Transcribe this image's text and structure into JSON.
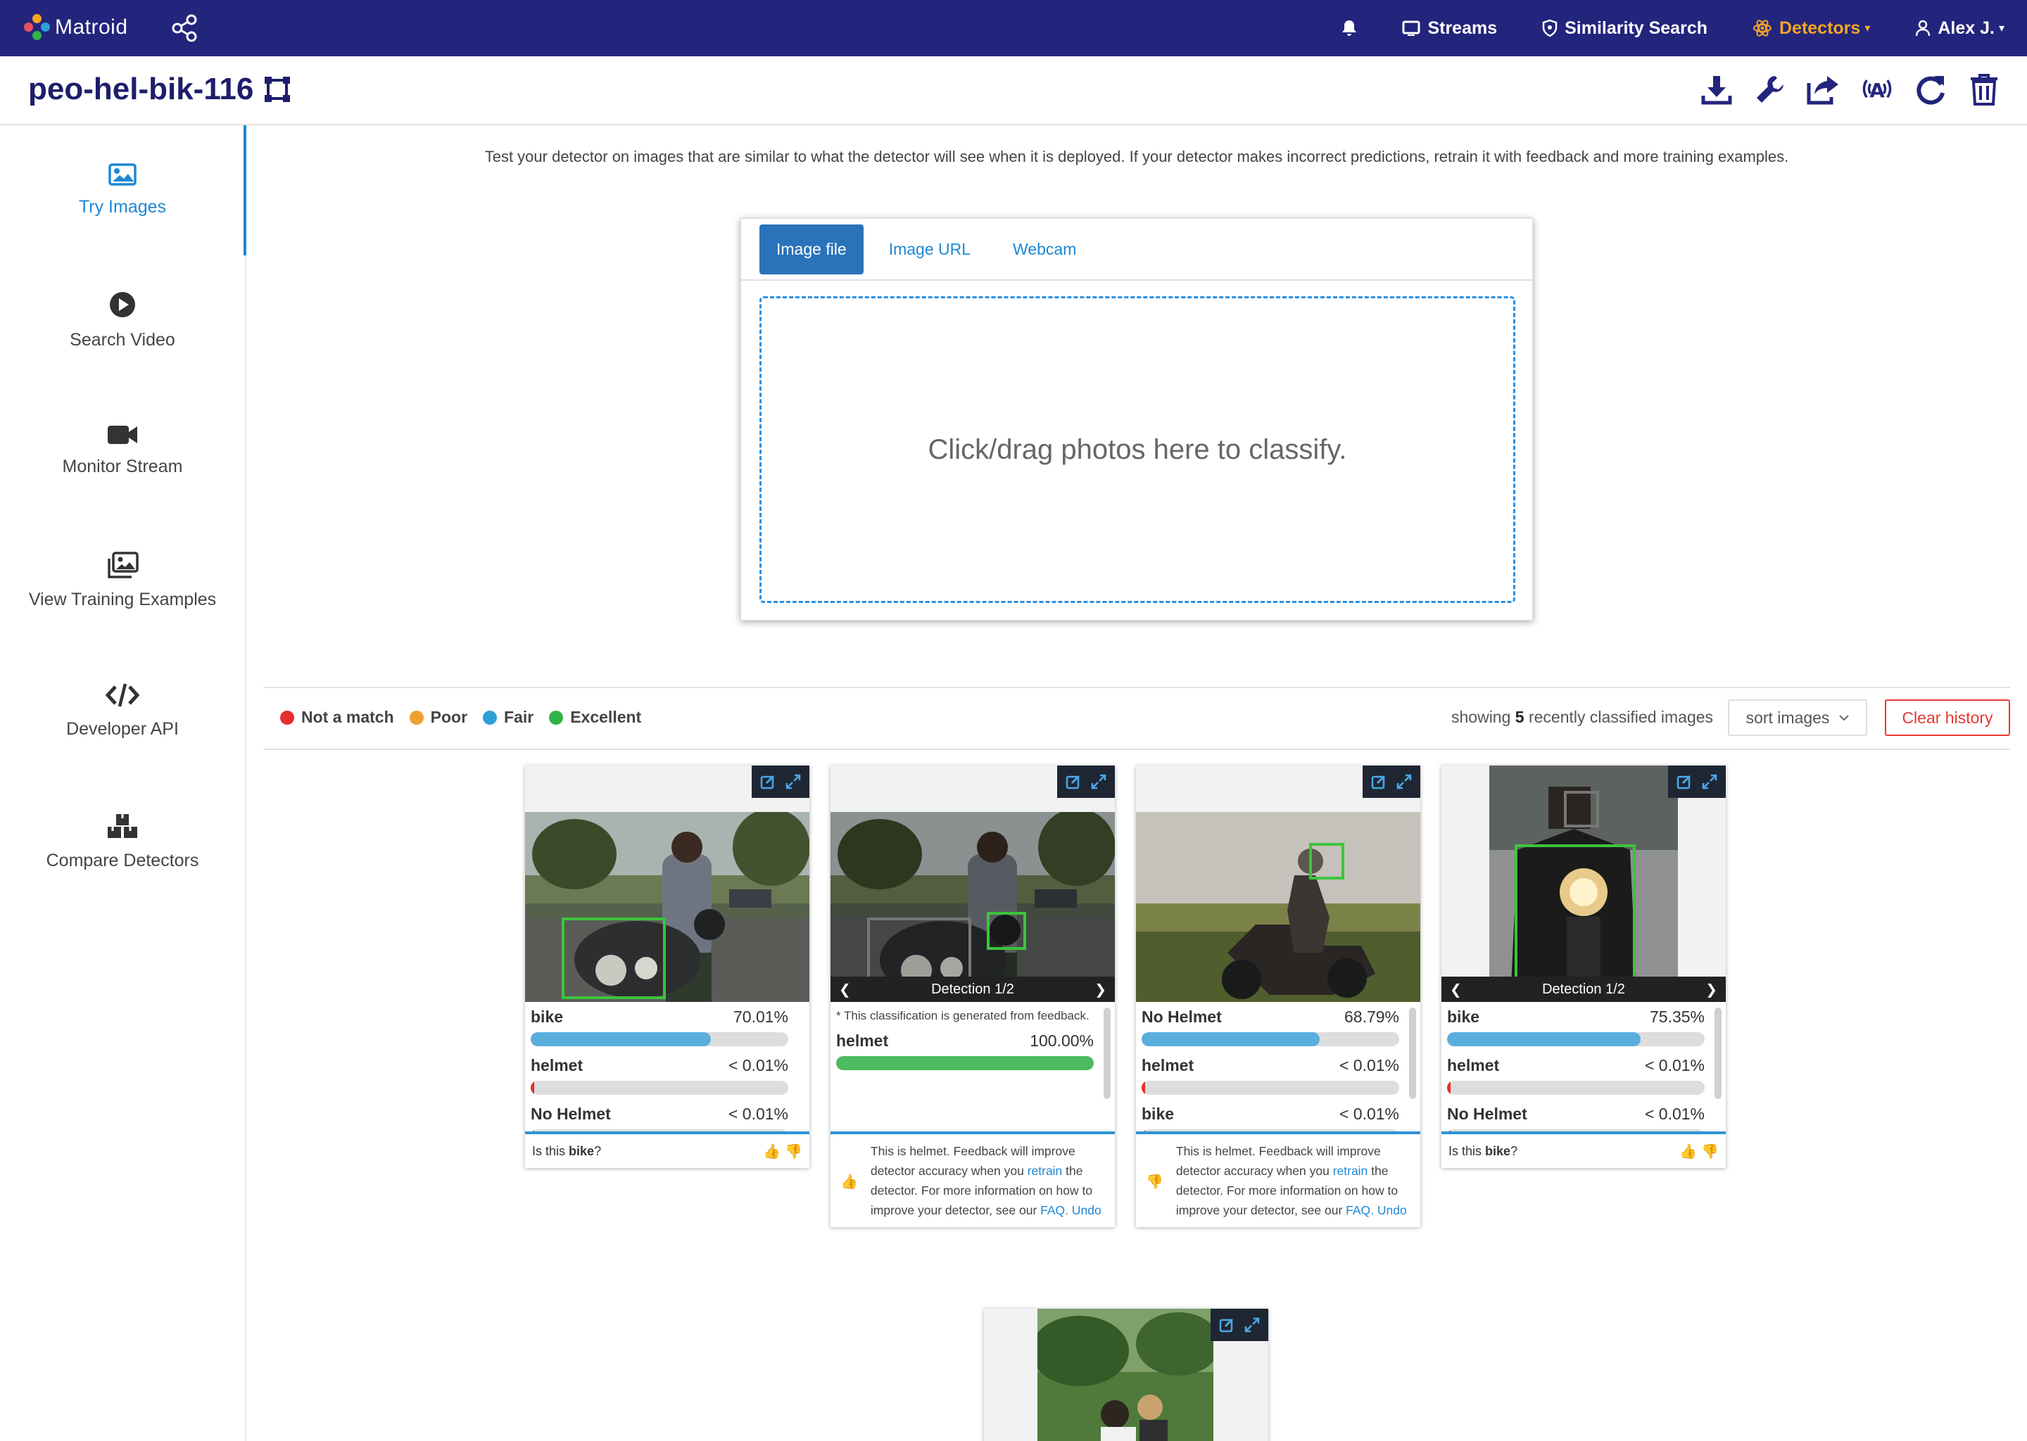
{
  "navbar": {
    "brand": "Matroid",
    "items": [
      {
        "label": "Streams",
        "icon": "tv-icon"
      },
      {
        "label": "Similarity Search",
        "icon": "shield-icon"
      },
      {
        "label": "Detectors",
        "icon": "atom-icon",
        "active": true
      },
      {
        "label": "Alex J.",
        "icon": "user-icon"
      }
    ]
  },
  "header": {
    "title": "peo-hel-bik-116",
    "tools": [
      "download-icon",
      "wrench-icon",
      "share-icon",
      "broadcast-icon",
      "refresh-icon",
      "trash-icon"
    ]
  },
  "sidebar": {
    "items": [
      {
        "label": "Try Images",
        "icon": "image-icon",
        "active": true
      },
      {
        "label": "Search Video",
        "icon": "play-icon"
      },
      {
        "label": "Monitor Stream",
        "icon": "video-camera-icon"
      },
      {
        "label": "View Training Examples",
        "icon": "images-icon"
      },
      {
        "label": "Developer API",
        "icon": "code-icon"
      },
      {
        "label": "Compare Detectors",
        "icon": "boxes-icon"
      }
    ]
  },
  "main": {
    "intro": "Test your detector on images that are similar to what the detector will see when it is deployed. If your detector makes incorrect predictions, retrain it with feedback and more training examples.",
    "tabs": [
      "Image file",
      "Image URL",
      "Webcam"
    ],
    "dropzone": "Click/drag photos here to classify."
  },
  "legend": [
    {
      "label": "Not a match",
      "color": "#e62e2e"
    },
    {
      "label": "Poor",
      "color": "#f0a030"
    },
    {
      "label": "Fair",
      "color": "#2d9fd8"
    },
    {
      "label": "Excellent",
      "color": "#2fb34a"
    }
  ],
  "history": {
    "showing_prefix": "showing",
    "showing_count": "5",
    "showing_suffix": "recently classified images",
    "sort_label": "sort images",
    "clear_label": "Clear history"
  },
  "cards": [
    {
      "scores": [
        {
          "label": "bike",
          "value": "70.01%",
          "fill": 0.7,
          "color": "#5aaedc"
        },
        {
          "label": "helmet",
          "value": "< 0.01%",
          "fill": 0.01,
          "color": "#e62e2e"
        },
        {
          "label": "No Helmet",
          "value": "< 0.01%",
          "fill": 0.01,
          "color": "#e62e2e"
        }
      ],
      "question_prefix": "Is this",
      "question_label": "bike",
      "question_suffix": "?"
    },
    {
      "detection": "Detection 1/2",
      "note": "* This classification is generated from feedback.",
      "scores": [
        {
          "label": "helmet",
          "value": "100.00%",
          "fill": 1.0,
          "color": "#4dbb5f"
        }
      ],
      "feedback": {
        "text_1": "This is helmet. Feedback will improve detector accuracy when you",
        "retrain": "retrain",
        "text_2": "the detector. For more information on how to improve your detector, see our",
        "faq": "FAQ.",
        "undo": "Undo"
      }
    },
    {
      "scores": [
        {
          "label": "No Helmet",
          "value": "68.79%",
          "fill": 0.69,
          "color": "#5aaedc"
        },
        {
          "label": "helmet",
          "value": "< 0.01%",
          "fill": 0.01,
          "color": "#e62e2e"
        },
        {
          "label": "bike",
          "value": "< 0.01%",
          "fill": 0.01,
          "color": "#e62e2e"
        }
      ],
      "feedback": {
        "text_1": "This is helmet. Feedback will improve detector accuracy when you",
        "retrain": "retrain",
        "text_2": "the detector. For more information on how to improve your detector, see our",
        "faq": "FAQ.",
        "undo": "Undo"
      }
    },
    {
      "detection": "Detection 1/2",
      "scores": [
        {
          "label": "bike",
          "value": "75.35%",
          "fill": 0.75,
          "color": "#5aaedc"
        },
        {
          "label": "helmet",
          "value": "< 0.01%",
          "fill": 0.01,
          "color": "#e62e2e"
        },
        {
          "label": "No Helmet",
          "value": "< 0.01%",
          "fill": 0.01,
          "color": "#e62e2e"
        }
      ],
      "question_prefix": "Is this",
      "question_label": "bike",
      "question_suffix": "?"
    }
  ]
}
